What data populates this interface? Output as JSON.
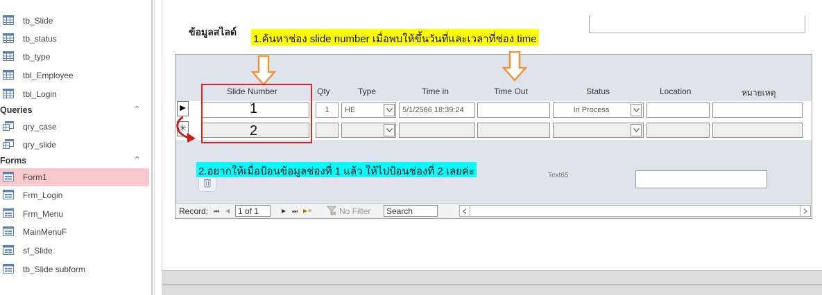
{
  "nav": {
    "tables": [
      {
        "label": "tb_Slide"
      },
      {
        "label": "tb_status"
      },
      {
        "label": "tb_type"
      },
      {
        "label": "tbl_Employee"
      },
      {
        "label": "tbl_Login"
      }
    ],
    "queries_header": "Queries",
    "queries": [
      {
        "label": "qry_case"
      },
      {
        "label": "qry_slide"
      }
    ],
    "forms_header": "Forms",
    "forms": [
      {
        "label": "Form1",
        "selected": true
      },
      {
        "label": "Frm_Login"
      },
      {
        "label": "Frm_Menu"
      },
      {
        "label": "MainMenuF"
      },
      {
        "label": "sf_Slide"
      },
      {
        "label": "tb_Slide subform"
      }
    ],
    "collapse_glyph": "⌃"
  },
  "form": {
    "section_title": "ข้อมูลสไลด์",
    "columns": [
      "Slide Number",
      "Qty",
      "Type",
      "Time in",
      "Time Out",
      "Status",
      "Location",
      "หมายเหตุ"
    ],
    "row1": {
      "slide_number": "",
      "qty": "1",
      "type": "HE",
      "time_in": "5/1/2566 18:39:24",
      "time_out": "",
      "status": "In Process",
      "location": "",
      "note": ""
    },
    "current_record_glyph": "▶",
    "new_record_glyph": "✳",
    "text65_label": "Text65"
  },
  "navbar": {
    "record_label": "Record:",
    "first": "⏮",
    "prev": "◀",
    "record_value": "1 of 1",
    "next": "▶",
    "last": "⏭",
    "new": "▶✳",
    "filter_label": "No Filter",
    "search_label": "Search"
  },
  "annotations": {
    "note1": "1.ค้นหาช่อง slide number เมื่อพบให้ขึ้นวันที่และเวลาที่ช่อง time",
    "note2": "2.อยากให้เมื่อป้อนข้อมูลช่องที่ 1 แล้ว ให้ไปป้อนช่องที่ 2 เลยค่ะ",
    "num1": "1",
    "num2": "2"
  },
  "colors": {
    "annot_yellow": "#ffff00",
    "annot_cyan": "#00ffff",
    "red_outline": "#e0231f",
    "orange_arrow": "#f0943a",
    "selected_form": "#f8c8cc"
  }
}
